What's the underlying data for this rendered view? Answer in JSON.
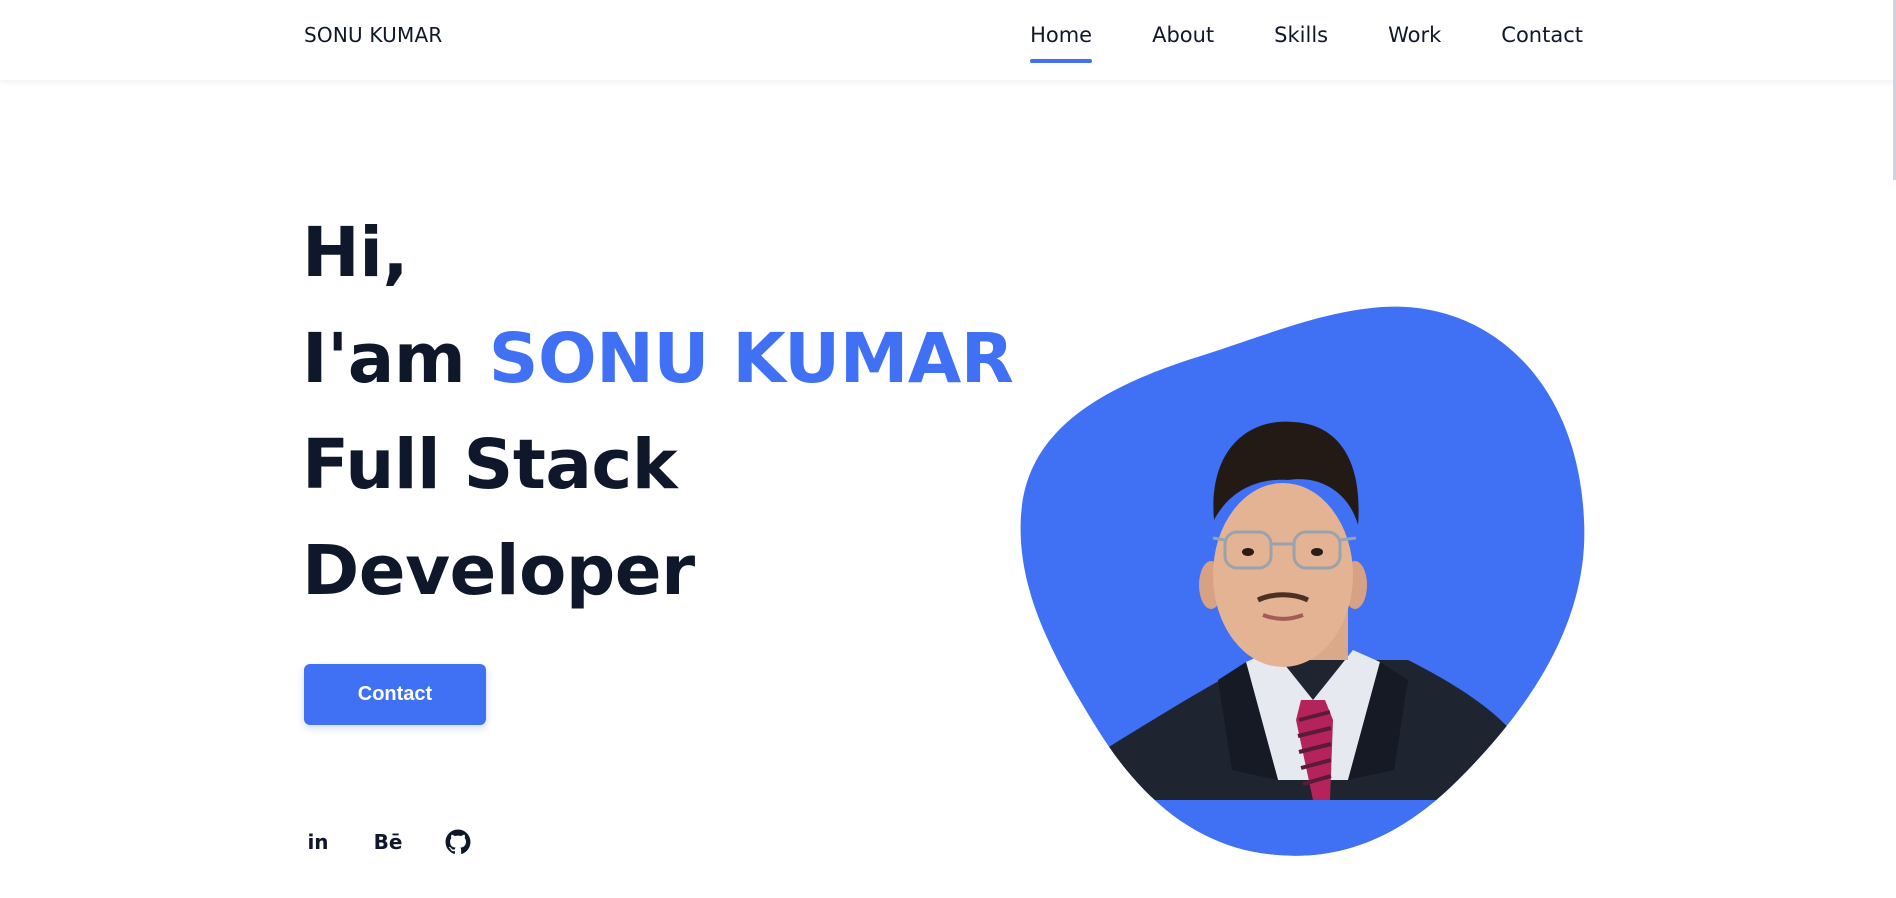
{
  "header": {
    "logo": "SONU KUMAR",
    "nav": [
      {
        "label": "Home",
        "active": true
      },
      {
        "label": "About",
        "active": false
      },
      {
        "label": "Skills",
        "active": false
      },
      {
        "label": "Work",
        "active": false
      },
      {
        "label": "Contact",
        "active": false
      }
    ]
  },
  "hero": {
    "line1": "Hi,",
    "line2_prefix": "I'am ",
    "name": "SONU KUMAR",
    "line3": "Full Stack",
    "line4": "Developer",
    "contact_button": "Contact"
  },
  "socials": {
    "linkedin": "in",
    "behance": "Bē",
    "github_icon": "github-icon"
  },
  "colors": {
    "accent": "#4070f4",
    "text": "#0f172a",
    "background": "#ffffff"
  }
}
